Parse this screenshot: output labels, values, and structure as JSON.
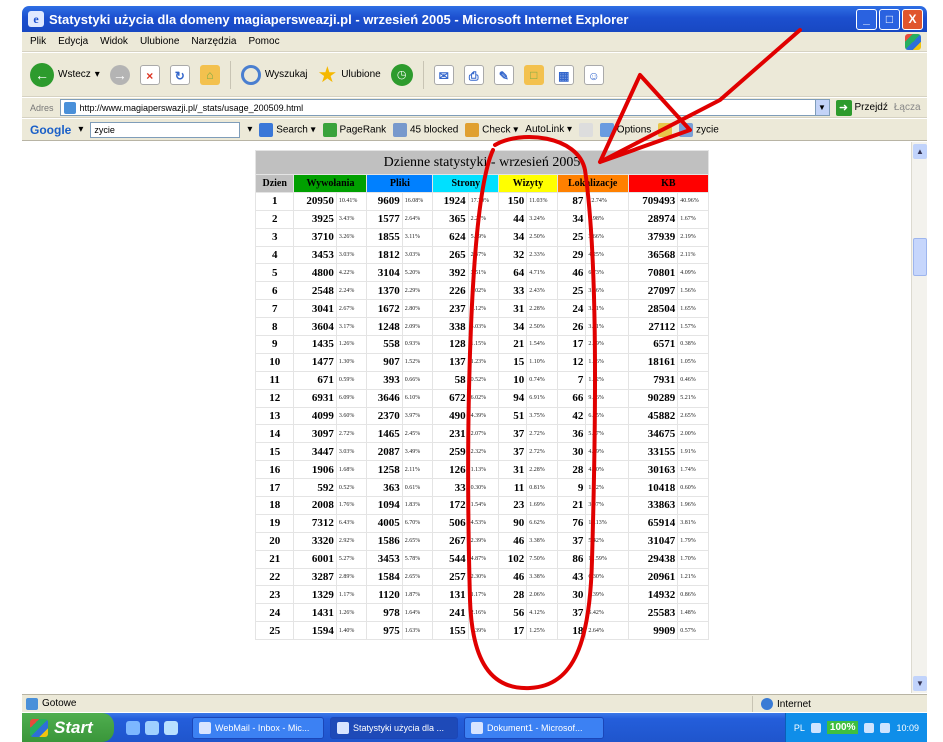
{
  "window": {
    "title": "Statystyki użycia dla domeny magiapersweazji.pl - wrzesień 2005 - Microsoft Internet Explorer",
    "controls": [
      "_",
      "□",
      "X"
    ]
  },
  "menu": [
    "Plik",
    "Edycja",
    "Widok",
    "Ulubione",
    "Narzędzia",
    "Pomoc"
  ],
  "toolbar": {
    "back": "Wstecz",
    "search": "Wyszukaj",
    "favorites": "Ulubione"
  },
  "address": {
    "label": "Adres",
    "url": "http://www.magiaperswazji.pl/_stats/usage_200509.html",
    "go": "Przejdź",
    "links": "Łącza"
  },
  "google": {
    "logo": "Google",
    "query": "zycie",
    "search": "Search",
    "pagerank": "PageRank",
    "blocked": "45 blocked",
    "check": "Check",
    "autolink": "AutoLink",
    "options": "Options",
    "zycie": "zycie"
  },
  "stats_table": {
    "caption": "Dzienne statystyki - wrzesień 2005",
    "headers": [
      {
        "label": "Dzien",
        "color": "#c0c0c0"
      },
      {
        "label": "Wywołania",
        "color": "#00a000"
      },
      {
        "label": "Pliki",
        "color": "#0080ff"
      },
      {
        "label": "Strony",
        "color": "#00e0ff"
      },
      {
        "label": "Wizyty",
        "color": "#ffff00"
      },
      {
        "label": "Lokalizacje",
        "color": "#ff8000"
      },
      {
        "label": "KB",
        "color": "#ff0000"
      }
    ],
    "rows": [
      [
        "1",
        "20950",
        "10.41%",
        "9609",
        "16.08%",
        "1924",
        "17.70%",
        "150",
        "11.03%",
        "87",
        "12.74%",
        "709493",
        "40.96%"
      ],
      [
        "2",
        "3925",
        "3.43%",
        "1577",
        "2.64%",
        "365",
        "2.27%",
        "44",
        "3.24%",
        "34",
        "4.98%",
        "28974",
        "1.67%"
      ],
      [
        "3",
        "3710",
        "3.26%",
        "1855",
        "3.11%",
        "624",
        "5.59%",
        "34",
        "2.50%",
        "25",
        "3.66%",
        "37939",
        "2.19%"
      ],
      [
        "4",
        "3453",
        "3.03%",
        "1812",
        "3.03%",
        "265",
        "2.37%",
        "32",
        "2.33%",
        "29",
        "4.25%",
        "36568",
        "2.11%"
      ],
      [
        "5",
        "4800",
        "4.22%",
        "3104",
        "5.20%",
        "392",
        "3.51%",
        "64",
        "4.71%",
        "46",
        "6.73%",
        "70801",
        "4.09%"
      ],
      [
        "6",
        "2548",
        "2.24%",
        "1370",
        "2.29%",
        "226",
        "2.02%",
        "33",
        "2.43%",
        "25",
        "3.66%",
        "27097",
        "1.56%"
      ],
      [
        "7",
        "3041",
        "2.67%",
        "1672",
        "2.80%",
        "237",
        "2.12%",
        "31",
        "2.28%",
        "24",
        "3.51%",
        "28504",
        "1.65%"
      ],
      [
        "8",
        "3604",
        "3.17%",
        "1248",
        "2.09%",
        "338",
        "3.03%",
        "34",
        "2.50%",
        "26",
        "3.81%",
        "27112",
        "1.57%"
      ],
      [
        "9",
        "1435",
        "1.26%",
        "558",
        "0.93%",
        "128",
        "1.15%",
        "21",
        "1.54%",
        "17",
        "2.49%",
        "6571",
        "0.38%"
      ],
      [
        "10",
        "1477",
        "1.30%",
        "907",
        "1.52%",
        "137",
        "1.23%",
        "15",
        "1.10%",
        "12",
        "1.76%",
        "18161",
        "1.05%"
      ],
      [
        "11",
        "671",
        "0.59%",
        "393",
        "0.66%",
        "58",
        "0.52%",
        "10",
        "0.74%",
        "7",
        "1.02%",
        "7931",
        "0.46%"
      ],
      [
        "12",
        "6931",
        "6.09%",
        "3646",
        "6.10%",
        "672",
        "6.02%",
        "94",
        "6.91%",
        "66",
        "9.66%",
        "90289",
        "5.21%"
      ],
      [
        "13",
        "4099",
        "3.60%",
        "2370",
        "3.97%",
        "490",
        "4.39%",
        "51",
        "3.75%",
        "42",
        "6.15%",
        "45882",
        "2.65%"
      ],
      [
        "14",
        "3097",
        "2.72%",
        "1465",
        "2.45%",
        "231",
        "2.07%",
        "37",
        "2.72%",
        "36",
        "5.27%",
        "34675",
        "2.00%"
      ],
      [
        "15",
        "3447",
        "3.03%",
        "2087",
        "3.49%",
        "259",
        "2.32%",
        "37",
        "2.72%",
        "30",
        "4.39%",
        "33155",
        "1.91%"
      ],
      [
        "16",
        "1906",
        "1.68%",
        "1258",
        "2.11%",
        "126",
        "1.13%",
        "31",
        "2.28%",
        "28",
        "4.10%",
        "30163",
        "1.74%"
      ],
      [
        "17",
        "592",
        "0.52%",
        "363",
        "0.61%",
        "33",
        "0.30%",
        "11",
        "0.81%",
        "9",
        "1.32%",
        "10418",
        "0.60%"
      ],
      [
        "18",
        "2008",
        "1.76%",
        "1094",
        "1.83%",
        "172",
        "1.54%",
        "23",
        "1.69%",
        "21",
        "3.07%",
        "33863",
        "1.96%"
      ],
      [
        "19",
        "7312",
        "6.43%",
        "4005",
        "6.70%",
        "506",
        "4.53%",
        "90",
        "6.62%",
        "76",
        "11.13%",
        "65914",
        "3.81%"
      ],
      [
        "20",
        "3320",
        "2.92%",
        "1586",
        "2.65%",
        "267",
        "2.39%",
        "46",
        "3.38%",
        "37",
        "5.42%",
        "31047",
        "1.79%"
      ],
      [
        "21",
        "6001",
        "5.27%",
        "3453",
        "5.78%",
        "544",
        "4.87%",
        "102",
        "7.50%",
        "86",
        "12.59%",
        "29438",
        "1.70%"
      ],
      [
        "22",
        "3287",
        "2.89%",
        "1584",
        "2.65%",
        "257",
        "2.30%",
        "46",
        "3.38%",
        "43",
        "6.30%",
        "20961",
        "1.21%"
      ],
      [
        "23",
        "1329",
        "1.17%",
        "1120",
        "1.87%",
        "131",
        "1.17%",
        "28",
        "2.06%",
        "30",
        "4.39%",
        "14932",
        "0.86%"
      ],
      [
        "24",
        "1431",
        "1.26%",
        "978",
        "1.64%",
        "241",
        "2.16%",
        "56",
        "4.12%",
        "37",
        "5.42%",
        "25583",
        "1.48%"
      ],
      [
        "25",
        "1594",
        "1.40%",
        "975",
        "1.63%",
        "155",
        "1.39%",
        "17",
        "1.25%",
        "18",
        "2.64%",
        "9909",
        "0.57%"
      ]
    ]
  },
  "status": {
    "text": "Gotowe",
    "zone": "Internet"
  },
  "taskbar": {
    "start": "Start",
    "tasks": [
      "WebMail - Inbox - Mic...",
      "Statystyki użycia dla ...",
      "Dokument1 - Microsof..."
    ],
    "tray_percent": "100%",
    "tray_lang": "PL",
    "clock": "10:09"
  },
  "annotation_color": "#e00000"
}
